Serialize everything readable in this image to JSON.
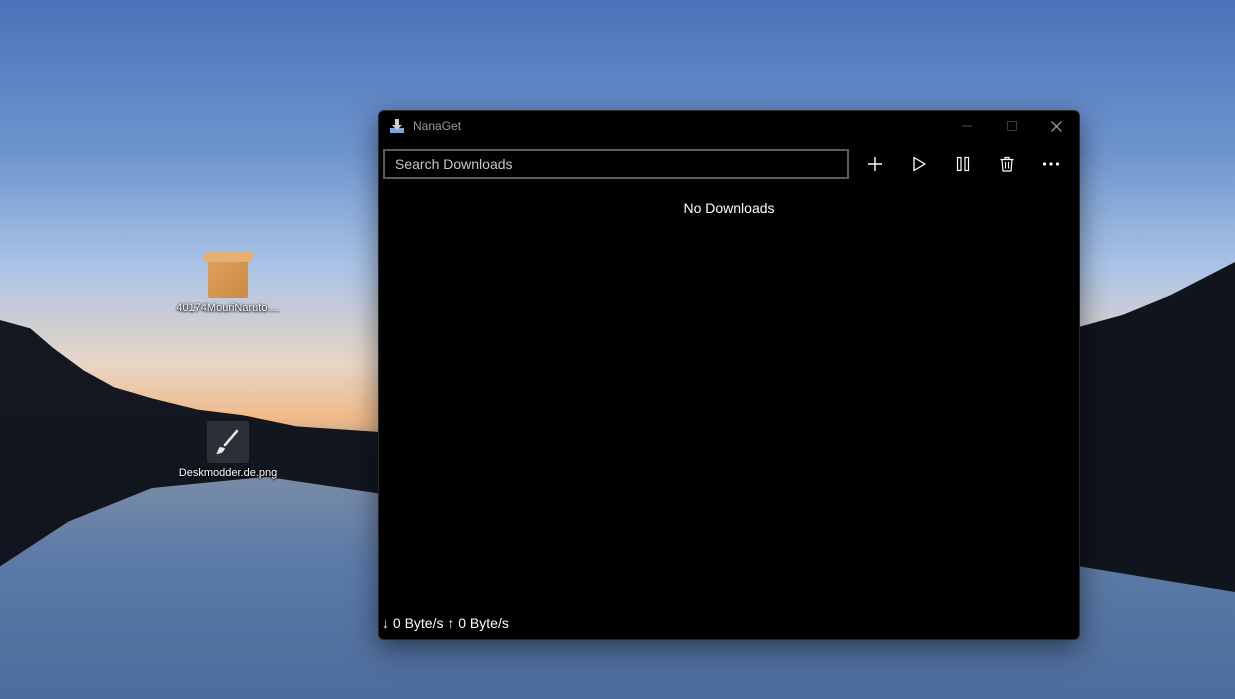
{
  "desktop": {
    "icons": [
      {
        "label": "40174MouriNaruto....",
        "icon": "package-icon"
      },
      {
        "label": "Deskmodder.de.png",
        "icon": "paintbrush-icon"
      }
    ]
  },
  "window": {
    "title": "NanaGet",
    "controls": [
      "minimize-icon",
      "maximize-icon",
      "close-icon"
    ]
  },
  "toolbar": {
    "search_placeholder": "Search Downloads",
    "search_value": "",
    "buttons": [
      "add-icon",
      "play-icon",
      "pause-icon",
      "delete-icon",
      "more-icon"
    ]
  },
  "main": {
    "empty_text": "No Downloads"
  },
  "status": {
    "speed_text": "↓ 0 Byte/s ↑ 0 Byte/s"
  },
  "colors": {
    "window_bg": "#000000",
    "search_border": "#5b5b5b",
    "title_text": "#9a9a9a"
  }
}
